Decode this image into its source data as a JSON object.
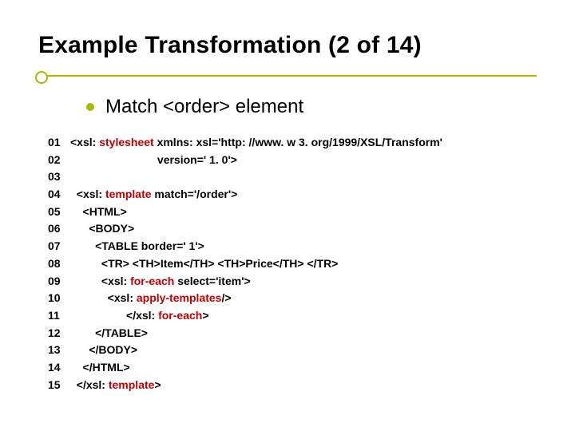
{
  "title": "Example Transformation (2 of 14)",
  "subtitle": "Match <order> element",
  "code": {
    "lines": [
      {
        "n": "01",
        "pre": "<xsl: ",
        "kw": "stylesheet",
        "post": " xmlns: xsl='http: //www. w 3. org/1999/XSL/Transform'"
      },
      {
        "n": "02",
        "pre": "                            version=' 1. 0'>",
        "kw": "",
        "post": ""
      },
      {
        "n": "03",
        "pre": "",
        "kw": "",
        "post": ""
      },
      {
        "n": "04",
        "pre": "  <xsl: ",
        "kw": "template",
        "post": " match='/order'>"
      },
      {
        "n": "05",
        "pre": "    <HTML>",
        "kw": "",
        "post": ""
      },
      {
        "n": "06",
        "pre": "      <BODY>",
        "kw": "",
        "post": ""
      },
      {
        "n": "07",
        "pre": "        <TABLE border=' 1'>",
        "kw": "",
        "post": ""
      },
      {
        "n": "08",
        "pre": "          <TR> <TH>Item</TH> <TH>Price</TH> </TR>",
        "kw": "",
        "post": ""
      },
      {
        "n": "09",
        "pre": "          <xsl: ",
        "kw": "for-each",
        "post": " select='item'>"
      },
      {
        "n": "10",
        "pre": "            <xsl: ",
        "kw": "apply-templates",
        "post": "/>"
      },
      {
        "n": "11",
        "pre": "                  </xsl: ",
        "kw": "for-each",
        "post": ">"
      },
      {
        "n": "12",
        "pre": "        </TABLE>",
        "kw": "",
        "post": ""
      },
      {
        "n": "13",
        "pre": "      </BODY>",
        "kw": "",
        "post": ""
      },
      {
        "n": "14",
        "pre": "    </HTML>",
        "kw": "",
        "post": ""
      },
      {
        "n": "15",
        "pre": "  </xsl: ",
        "kw": "template",
        "post": ">"
      }
    ]
  }
}
